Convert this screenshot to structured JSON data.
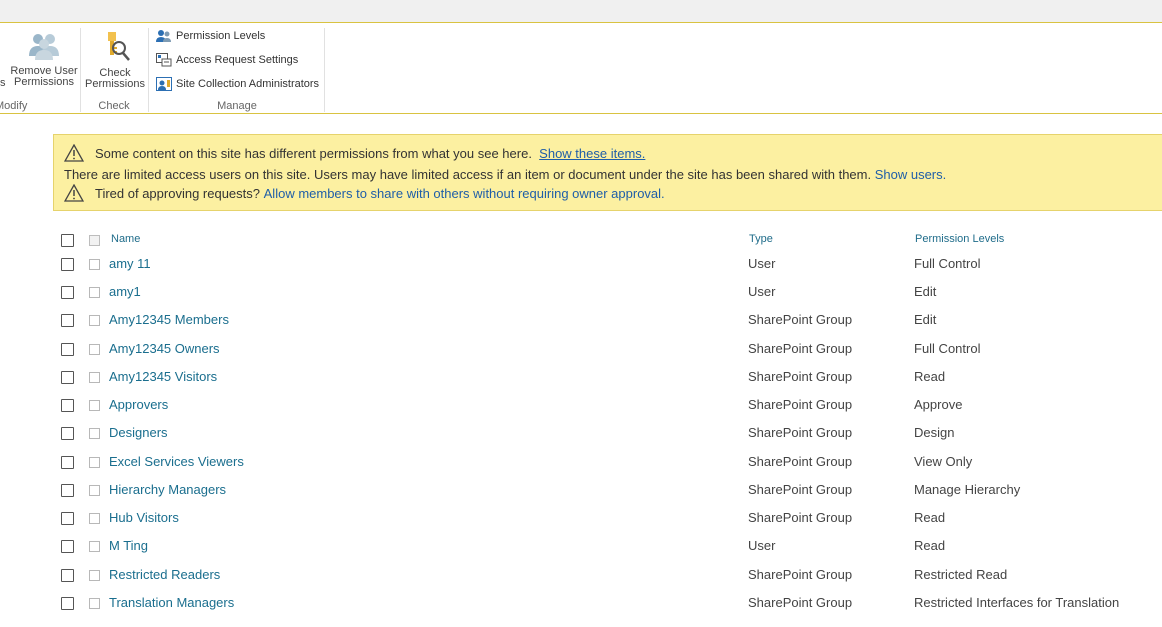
{
  "ribbon": {
    "partial_left_label": "s",
    "modify_group_label": "Modify",
    "remove_user_permissions_label_1": "Remove User",
    "remove_user_permissions_label_2": "Permissions",
    "check_permissions_label_1": "Check",
    "check_permissions_label_2": "Permissions",
    "check_group_label": "Check",
    "permission_levels_label": "Permission Levels",
    "access_request_settings_label": "Access Request Settings",
    "site_collection_admins_label": "Site Collection Administrators",
    "manage_group_label": "Manage"
  },
  "notice": {
    "line1_text": "Some content on this site has different permissions from what you see here.",
    "line1_link": "Show these items.",
    "line2_text": "There are limited access users on this site. Users may have limited access if an item or document under the site has been shared with them.",
    "line2_link": "Show users.",
    "line3_text": "Tired of approving requests?",
    "line3_link": "Allow members to share with others without requiring owner approval."
  },
  "table": {
    "headers": {
      "name": "Name",
      "type": "Type",
      "permission_levels": "Permission Levels"
    },
    "rows": [
      {
        "name": "amy 11",
        "type": "User",
        "permission": "Full Control"
      },
      {
        "name": "amy1",
        "type": "User",
        "permission": "Edit"
      },
      {
        "name": "Amy12345 Members",
        "type": "SharePoint Group",
        "permission": "Edit"
      },
      {
        "name": "Amy12345 Owners",
        "type": "SharePoint Group",
        "permission": "Full Control"
      },
      {
        "name": "Amy12345 Visitors",
        "type": "SharePoint Group",
        "permission": "Read"
      },
      {
        "name": "Approvers",
        "type": "SharePoint Group",
        "permission": "Approve"
      },
      {
        "name": "Designers",
        "type": "SharePoint Group",
        "permission": "Design"
      },
      {
        "name": "Excel Services Viewers",
        "type": "SharePoint Group",
        "permission": "View Only"
      },
      {
        "name": "Hierarchy Managers",
        "type": "SharePoint Group",
        "permission": "Manage Hierarchy"
      },
      {
        "name": "Hub Visitors",
        "type": "SharePoint Group",
        "permission": "Read"
      },
      {
        "name": "M Ting",
        "type": "User",
        "permission": "Read"
      },
      {
        "name": "Restricted Readers",
        "type": "SharePoint Group",
        "permission": "Restricted Read"
      },
      {
        "name": "Translation Managers",
        "type": "SharePoint Group",
        "permission": "Restricted Interfaces for Translation"
      }
    ]
  },
  "colors": {
    "accent_border": "#d9c341",
    "notice_bg": "#fcf0a1",
    "link": "#1f5ea8",
    "name_link": "#1a6e8e"
  }
}
